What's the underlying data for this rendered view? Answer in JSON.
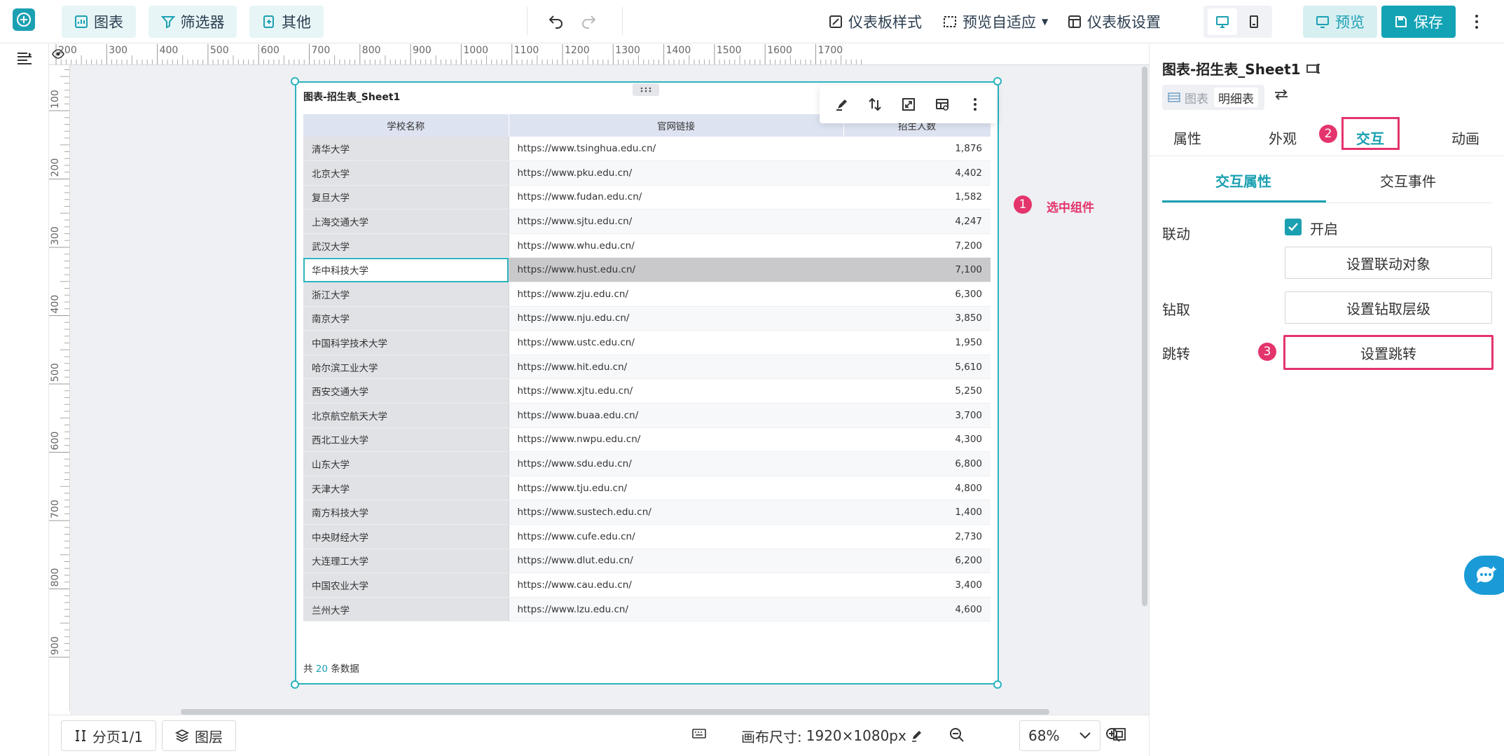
{
  "toolbar": {
    "chart_label": "图表",
    "filter_label": "筛选器",
    "other_label": "其他",
    "dashboard_style_label": "仪表板样式",
    "preview_adaptive_label": "预览自适应",
    "dashboard_settings_label": "仪表板设置",
    "preview_label": "预览",
    "save_label": "保存"
  },
  "ruler": {
    "h_ticks": [
      "200",
      "300",
      "400",
      "500",
      "600",
      "700",
      "800",
      "900",
      "1000",
      "1100",
      "1200",
      "1300",
      "1400",
      "1500",
      "1600",
      "1700"
    ],
    "v_ticks": [
      "100",
      "200",
      "300",
      "400",
      "500",
      "600",
      "700",
      "800",
      "900"
    ]
  },
  "widget": {
    "title": "图表-招生表_Sheet1",
    "columns": [
      "学校名称",
      "官网链接",
      "招生人数"
    ],
    "rows": [
      [
        "清华大学",
        "https://www.tsinghua.edu.cn/",
        "1,876"
      ],
      [
        "北京大学",
        "https://www.pku.edu.cn/",
        "4,402"
      ],
      [
        "复旦大学",
        "https://www.fudan.edu.cn/",
        "1,582"
      ],
      [
        "上海交通大学",
        "https://www.sjtu.edu.cn/",
        "4,247"
      ],
      [
        "武汉大学",
        "https://www.whu.edu.cn/",
        "7,200"
      ],
      [
        "华中科技大学",
        "https://www.hust.edu.cn/",
        "7,100"
      ],
      [
        "浙江大学",
        "https://www.zju.edu.cn/",
        "6,300"
      ],
      [
        "南京大学",
        "https://www.nju.edu.cn/",
        "3,850"
      ],
      [
        "中国科学技术大学",
        "https://www.ustc.edu.cn/",
        "1,950"
      ],
      [
        "哈尔滨工业大学",
        "https://www.hit.edu.cn/",
        "5,610"
      ],
      [
        "西安交通大学",
        "https://www.xjtu.edu.cn/",
        "5,250"
      ],
      [
        "北京航空航天大学",
        "https://www.buaa.edu.cn/",
        "3,700"
      ],
      [
        "西北工业大学",
        "https://www.nwpu.edu.cn/",
        "4,300"
      ],
      [
        "山东大学",
        "https://www.sdu.edu.cn/",
        "6,800"
      ],
      [
        "天津大学",
        "https://www.tju.edu.cn/",
        "4,800"
      ],
      [
        "南方科技大学",
        "https://www.sustech.edu.cn/",
        "1,400"
      ],
      [
        "中央财经大学",
        "https://www.cufe.edu.cn/",
        "2,730"
      ],
      [
        "大连理工大学",
        "https://www.dlut.edu.cn/",
        "6,200"
      ],
      [
        "中国农业大学",
        "https://www.cau.edu.cn/",
        "3,400"
      ],
      [
        "兰州大学",
        "https://www.lzu.edu.cn/",
        "4,600"
      ]
    ],
    "selected_row": 5,
    "footer_prefix": "共",
    "footer_count": "20",
    "footer_suffix": "条数据"
  },
  "annotations": {
    "step1_num": "1",
    "step1_text": "选中组件",
    "step2_num": "2",
    "step3_num": "3"
  },
  "bottombar": {
    "page_label": "分页1/1",
    "layer_label": "图层",
    "canvas_size_label": "画布尺寸:",
    "canvas_size_value": "1920×1080px",
    "zoom_value": "68%"
  },
  "panel": {
    "title": "图表-招生表_Sheet1",
    "switch_chart": "图表",
    "switch_detail": "明细表",
    "tabs": [
      "属性",
      "外观",
      "交互",
      "动画"
    ],
    "active_tab": 2,
    "subtabs": [
      "交互属性",
      "交互事件"
    ],
    "linkage_label": "联动",
    "linkage_enabled_label": "开启",
    "linkage_button": "设置联动对象",
    "drill_label": "钻取",
    "drill_button": "设置钻取层级",
    "jump_label": "跳转",
    "jump_button": "设置跳转"
  },
  "colors": {
    "accent": "#1ba0b2",
    "annotation": "#e4346c",
    "selection": "#2bb3be"
  }
}
